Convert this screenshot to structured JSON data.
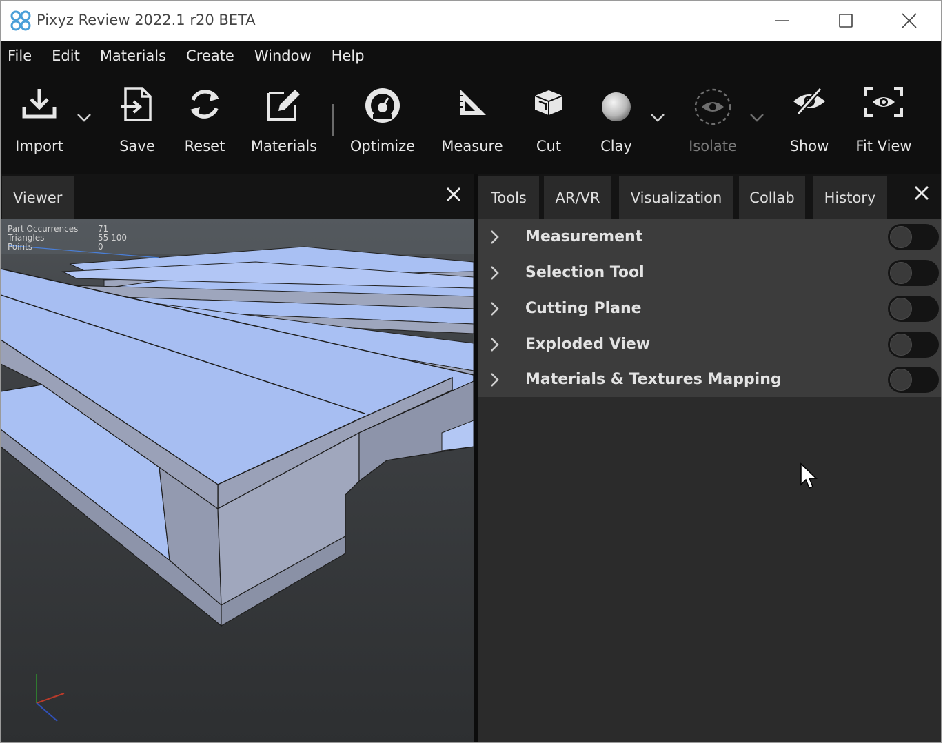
{
  "window": {
    "title": "Pixyz Review 2022.1 r20 BETA",
    "controls": [
      "minimize",
      "maximize",
      "close"
    ]
  },
  "menubar": {
    "items": [
      "File",
      "Edit",
      "Materials",
      "Create",
      "Window",
      "Help"
    ]
  },
  "toolbar": {
    "import": "Import",
    "save": "Save",
    "reset": "Reset",
    "materials": "Materials",
    "optimize": "Optimize",
    "measure": "Measure",
    "cut": "Cut",
    "clay": "Clay",
    "isolate": "Isolate",
    "show": "Show",
    "fit_view": "Fit View"
  },
  "viewer": {
    "tab_label": "Viewer",
    "stats": [
      {
        "label": "Part Occurrences",
        "value": "71"
      },
      {
        "label": "Triangles",
        "value": "55 100"
      },
      {
        "label": "Points",
        "value": "0"
      }
    ]
  },
  "right_panel": {
    "tabs": [
      "Tools",
      "AR/VR",
      "Visualization",
      "Collab",
      "History"
    ],
    "active_tab": "Tools",
    "tools": [
      {
        "name": "Measurement",
        "enabled": false
      },
      {
        "name": "Selection Tool",
        "enabled": false
      },
      {
        "name": "Cutting Plane",
        "enabled": false
      },
      {
        "name": "Exploded View",
        "enabled": false
      },
      {
        "name": "Materials & Textures Mapping",
        "enabled": false
      }
    ]
  },
  "colors": {
    "titlebar_bg": "#ffffff",
    "toolbar_bg": "#0f0f0f",
    "panel_bg": "#2b2b2b",
    "tool_list_bg": "#3c3c3c",
    "pallet_top": "#a7bef2",
    "pallet_side": "#9aa1b8",
    "brand_icon": "#4a9fd8"
  }
}
